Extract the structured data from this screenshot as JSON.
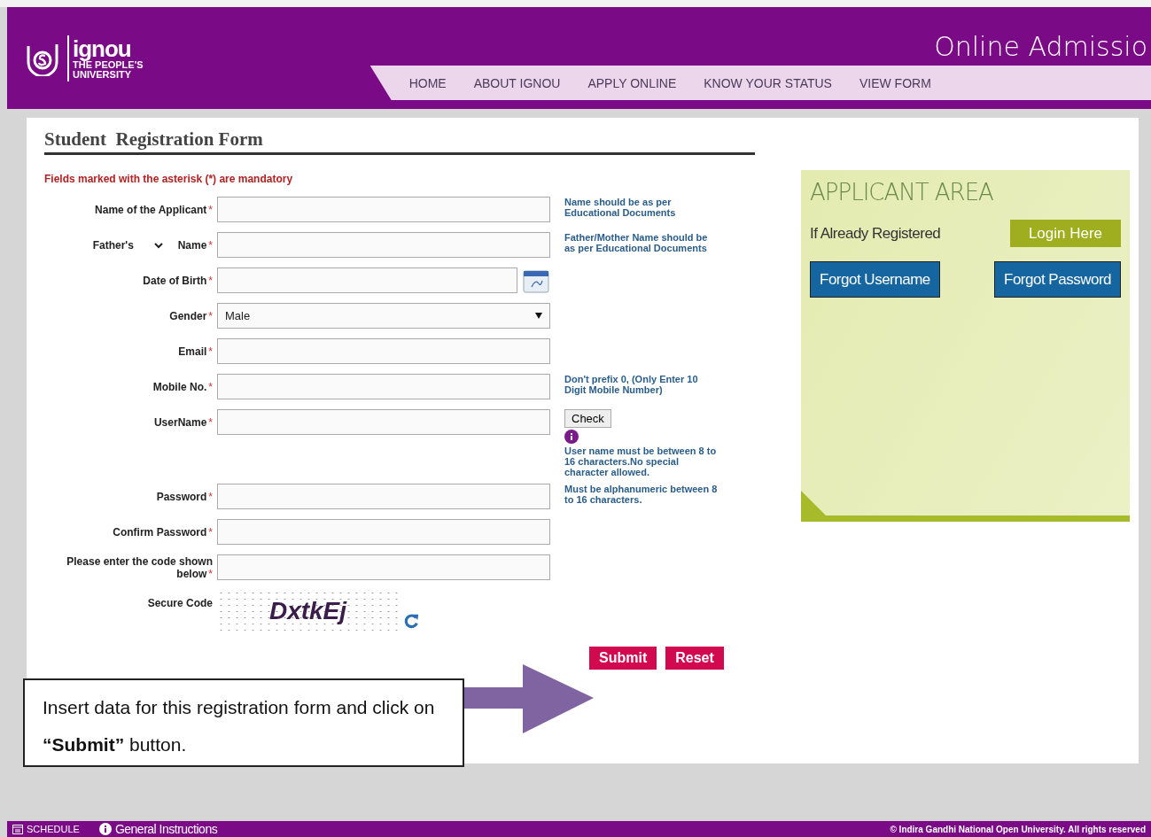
{
  "header": {
    "logo": {
      "name": "ignou",
      "tagline": [
        "THE PEOPLE'S",
        "UNIVERSITY"
      ]
    },
    "title": "Online Admissio",
    "nav": [
      {
        "label": "HOME"
      },
      {
        "label": "ABOUT IGNOU"
      },
      {
        "label": "APPLY ONLINE"
      },
      {
        "label": "KNOW YOUR STATUS"
      },
      {
        "label": "VIEW FORM"
      }
    ]
  },
  "form": {
    "title": "Student  Registration Form",
    "note": "Fields marked with the asterisk (*) are mandatory",
    "fields": [
      {
        "kind": "text",
        "label": "Name of the Applicant",
        "asterisk": "*",
        "hint": "Name should be as per Educational Documents"
      },
      {
        "kind": "relation",
        "relation": "Father's",
        "label": "Name",
        "asterisk": "*",
        "hint": "Father/Mother Name should be as per Educational Documents"
      },
      {
        "kind": "date",
        "label": "Date of Birth",
        "asterisk": "*"
      },
      {
        "kind": "select",
        "label": "Gender",
        "asterisk": "*",
        "value": "Male"
      },
      {
        "kind": "text",
        "label": "Email",
        "asterisk": "*"
      },
      {
        "kind": "text",
        "label": "Mobile No.",
        "asterisk": "*",
        "hint": "Don't prefix 0, (Only Enter 10 Digit Mobile Number)"
      },
      {
        "kind": "check",
        "label": "UserName",
        "asterisk": "*",
        "button": "Check",
        "hint": "User name must be between 8 to 16 characters.No special character allowed."
      },
      {
        "kind": "text",
        "label": "Password",
        "asterisk": "*",
        "hint": "Must be alphanumeric between 8 to 16 characters."
      },
      {
        "kind": "text",
        "label": "Confirm Password",
        "asterisk": "*"
      },
      {
        "kind": "text",
        "label": "Please enter the code shown below",
        "asterisk": "*"
      },
      {
        "kind": "captcha",
        "label": "Secure Code",
        "code": "DxtkEj"
      }
    ],
    "buttons": [
      {
        "label": "Submit"
      },
      {
        "label": "Reset"
      }
    ]
  },
  "applicant_area": {
    "title": "APPLICANT AREA",
    "prompt": "If Already Registered",
    "login": "Login Here",
    "buttons": [
      {
        "label": "Forgot Username"
      },
      {
        "label": "Forgot Password"
      }
    ]
  },
  "callout": {
    "text": "Insert data for this registration form and click on **“Submit”** button."
  },
  "footer": {
    "links": [
      {
        "kind": "calendar",
        "label": "SCHEDULE"
      },
      {
        "kind": "info",
        "label": "General Instructions"
      }
    ],
    "copyright": "© Indira Gandhi National Open University. All rights reserved"
  }
}
